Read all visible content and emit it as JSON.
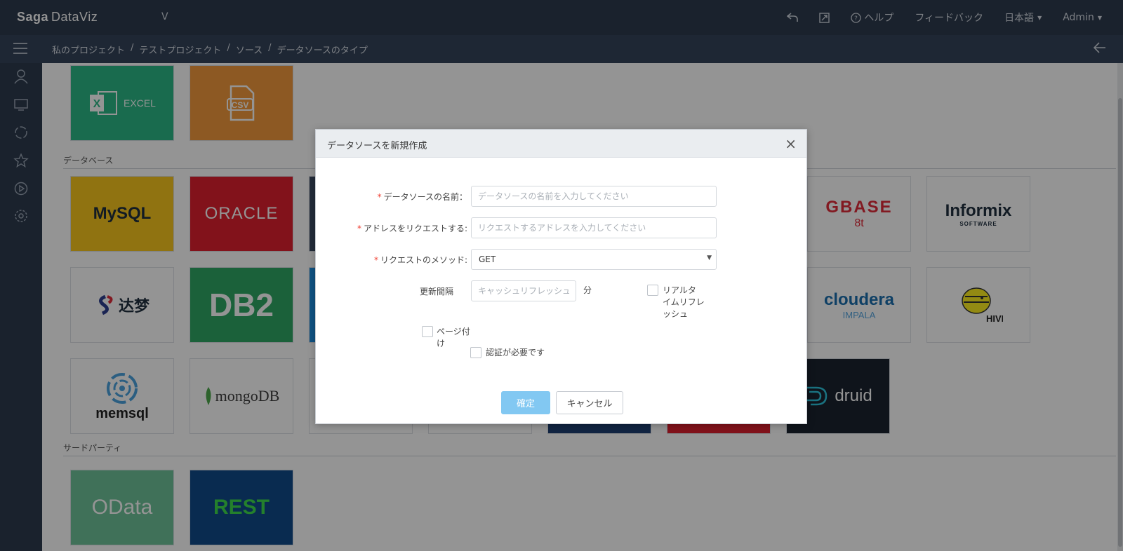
{
  "app": {
    "logo_main": "Saga",
    "logo_sub": "DataViz",
    "version": "V"
  },
  "header": {
    "help_label": "ヘルプ",
    "feedback_label": "フィードバック",
    "language_label": "日本語",
    "user_label": "Admin"
  },
  "breadcrumb": [
    "私のプロジェクト",
    "テストプロジェクト",
    "ソース",
    "データソースのタイプ"
  ],
  "sections": {
    "database_title": "データベース",
    "thirdparty_title": "サードパーティ"
  },
  "tiles": {
    "excel": "EXCEL",
    "csv": "CSV",
    "mysql": "MySQL",
    "oracle": "ORACLE",
    "gbase": "GBASE",
    "gbase_sub": "8t",
    "informix": "Informix",
    "informix_sub": "SOFTWARE",
    "dameng": "达梦",
    "db2": "DB2",
    "cloudera": "cloudera",
    "cloudera_sub": "IMPALA",
    "hive": "HIVE",
    "memsql": "memsql",
    "mongodb": "mongoDB",
    "druid": "druid",
    "odata": "OData",
    "rest": "REST"
  },
  "modal": {
    "title": "データソースを新規作成",
    "close": "×",
    "name_label": "データソースの名前：",
    "name_placeholder": "データソースの名前を入力してください",
    "address_label": "アドレスをリクエストする:",
    "address_placeholder": "リクエストするアドレスを入力してください",
    "method_label": "リクエストのメソッド:",
    "method_value": "GET",
    "refresh_label": "更新間隔",
    "refresh_placeholder": "キャッシュリフレッシュ",
    "minute_label": "分",
    "realtime_label_1": "リアルタ",
    "realtime_label_2": "イムリフレ",
    "realtime_label_3": "ッシュ",
    "paging_label_1": "ページ付",
    "paging_label_2": "け",
    "auth_label": "認証が必要です",
    "ok_button": "確定",
    "cancel_button": "キャンセル"
  }
}
